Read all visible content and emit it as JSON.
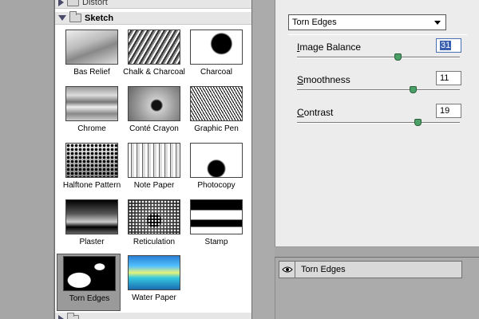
{
  "browser": {
    "categories": {
      "distort": "Distort",
      "sketch": "Sketch"
    },
    "thumbs": [
      {
        "label": "Bas Relief",
        "icon": "bas-relief-thumb"
      },
      {
        "label": "Chalk & Charcoal",
        "icon": "chalk-charcoal-thumb"
      },
      {
        "label": "Charcoal",
        "icon": "charcoal-thumb"
      },
      {
        "label": "Chrome",
        "icon": "chrome-thumb"
      },
      {
        "label": "Conté Crayon",
        "icon": "conte-crayon-thumb"
      },
      {
        "label": "Graphic Pen",
        "icon": "graphic-pen-thumb"
      },
      {
        "label": "Halftone Pattern",
        "icon": "halftone-pattern-thumb"
      },
      {
        "label": "Note Paper",
        "icon": "note-paper-thumb"
      },
      {
        "label": "Photocopy",
        "icon": "photocopy-thumb"
      },
      {
        "label": "Plaster",
        "icon": "plaster-thumb"
      },
      {
        "label": "Reticulation",
        "icon": "reticulation-thumb"
      },
      {
        "label": "Stamp",
        "icon": "stamp-thumb"
      },
      {
        "label": "Torn Edges",
        "icon": "torn-edges-thumb",
        "selected": true
      },
      {
        "label": "Water Paper",
        "icon": "water-paper-thumb"
      }
    ]
  },
  "settings": {
    "filter_select": "Torn Edges",
    "params": [
      {
        "label_first": "I",
        "label_rest": "mage Balance",
        "value": "31",
        "focused": true,
        "fraction": 0.62
      },
      {
        "label_first": "S",
        "label_rest": "moothness",
        "value": "11",
        "focused": false,
        "fraction": 0.71
      },
      {
        "label_first": "C",
        "label_rest": "ontrast",
        "value": "19",
        "focused": false,
        "fraction": 0.74
      }
    ]
  },
  "layers": {
    "item": "Torn Edges",
    "icon": "eye-icon"
  }
}
